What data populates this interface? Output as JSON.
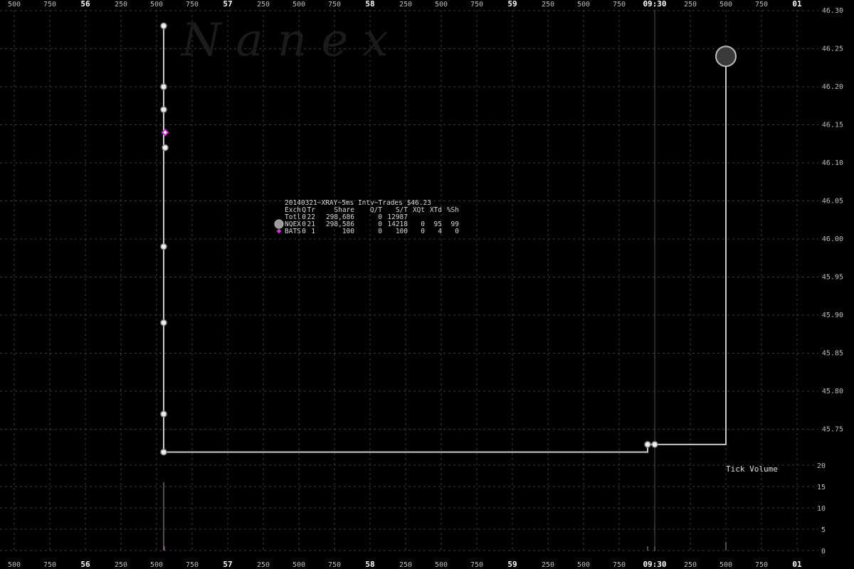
{
  "chart_data": {
    "type": "line",
    "watermark": "N a n e x",
    "title": "20140321~XRAY~5ms Intv~Trades $46.23",
    "x_axis": {
      "labels": [
        "500",
        "750",
        "56",
        "250",
        "500",
        "750",
        "57",
        "250",
        "500",
        "750",
        "58",
        "250",
        "500",
        "750",
        "59",
        "250",
        "500",
        "750",
        "09:30",
        "250",
        "500",
        "750",
        "01"
      ],
      "major_labels": [
        "56",
        "57",
        "58",
        "59",
        "09:30",
        "01"
      ]
    },
    "y_axis_price": {
      "ylim": [
        45.7,
        46.3
      ],
      "labels": [
        "46.30",
        "46.25",
        "46.20",
        "46.15",
        "46.10",
        "46.05",
        "46.00",
        "45.95",
        "45.90",
        "45.85",
        "45.80",
        "45.75"
      ]
    },
    "y_axis_volume": {
      "label": "Tick Volume",
      "ylim": [
        0,
        20
      ],
      "labels": [
        "20",
        "15",
        "10",
        "5",
        "0"
      ]
    },
    "legend": {
      "header": [
        "Exch",
        "Q",
        "Tr",
        "Share",
        "Q/T",
        "S/T",
        "XQt",
        "XTd",
        "%Sh"
      ],
      "rows": [
        {
          "name": "Totl",
          "cols": [
            "Totl",
            "0",
            "22",
            "298,686",
            "0",
            "12987",
            "",
            "",
            ""
          ],
          "marker": "none"
        },
        {
          "name": "NQEX",
          "cols": [
            "NQEX",
            "0",
            "21",
            "298,586",
            "0",
            "14218",
            "0",
            "95",
            "99"
          ],
          "marker": "circle",
          "color": "#9a9a9a"
        },
        {
          "name": "BATS",
          "cols": [
            "BATS",
            "0",
            "1",
            "100",
            "0",
            "100",
            "0",
            "4",
            "0"
          ],
          "marker": "diamond",
          "color": "#cc33cc"
        }
      ]
    },
    "colors": {
      "price_line": "#c8c8c8",
      "nqex": "#bdbdbd",
      "bats": "#cc33cc",
      "grid": "#3a3a3a",
      "background": "#000000"
    },
    "trade_points": [
      {
        "x": 0.0,
        "y": 46.28,
        "exch": "NQEX"
      },
      {
        "x": 0.0,
        "y": 46.2,
        "exch": "NQEX"
      },
      {
        "x": 0.0,
        "y": 46.17,
        "exch": "NQEX"
      },
      {
        "x": 0.01,
        "y": 46.14,
        "exch": "BATS"
      },
      {
        "x": 0.01,
        "y": 46.12,
        "exch": "NQEX"
      },
      {
        "x": 0.0,
        "y": 45.99,
        "exch": "NQEX"
      },
      {
        "x": 0.0,
        "y": 45.89,
        "exch": "NQEX"
      },
      {
        "x": 0.0,
        "y": 45.77,
        "exch": "NQEX"
      },
      {
        "x": 0.0,
        "y": 45.72,
        "exch": "NQEX"
      },
      {
        "x": 3.4,
        "y": 45.73,
        "exch": "NQEX"
      },
      {
        "x": 3.45,
        "y": 45.73,
        "exch": "NQEX"
      },
      {
        "x": 3.95,
        "y": 46.24,
        "exch": "NQEX"
      }
    ],
    "price_path": [
      {
        "x": 0.0,
        "y": 46.28
      },
      {
        "x": 0.0,
        "y": 45.72
      },
      {
        "x": 3.4,
        "y": 45.72
      },
      {
        "x": 3.4,
        "y": 45.73
      },
      {
        "x": 3.95,
        "y": 45.73
      },
      {
        "x": 3.95,
        "y": 46.24
      }
    ],
    "volume_bars": [
      {
        "x": 0.0,
        "v": 16,
        "color": "#9a9a9a"
      },
      {
        "x": 0.0,
        "v": 1,
        "color": "#cc33cc"
      },
      {
        "x": 3.4,
        "v": 1,
        "color": "#9a9a9a"
      },
      {
        "x": 3.45,
        "v": 1,
        "color": "#9a9a9a"
      },
      {
        "x": 3.95,
        "v": 2,
        "color": "#9a9a9a"
      }
    ]
  }
}
